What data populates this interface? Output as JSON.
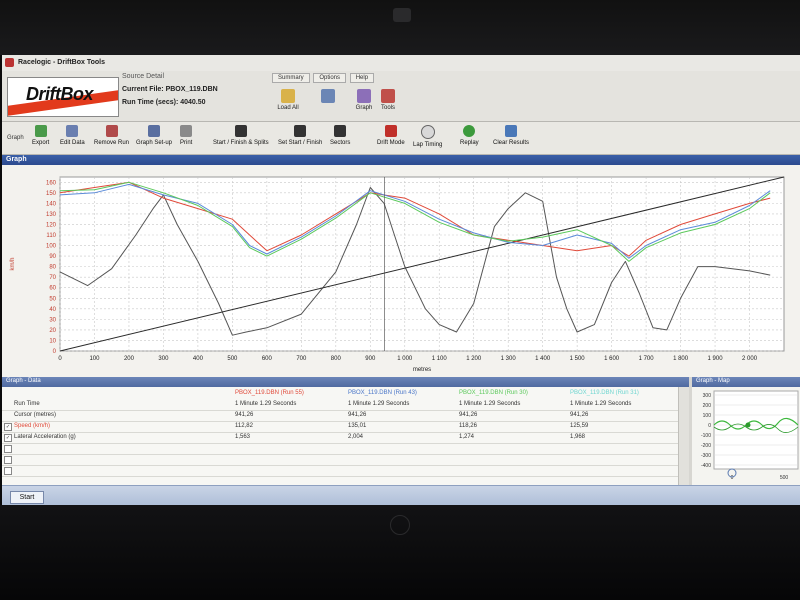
{
  "window": {
    "title": "Racelogic - DriftBox Tools"
  },
  "logo": {
    "text": "DriftBox"
  },
  "source_detail": {
    "header": "Source Detail",
    "current_file_label": "Current File:",
    "current_file": "PBOX_119.DBN",
    "run_time_label": "Run Time (secs):",
    "run_time": "4040.50"
  },
  "menu_tabs": [
    "Summary",
    "Options",
    "Help"
  ],
  "ribbon_buttons": {
    "load_all": "Load All",
    "graph": "Graph",
    "tools": "Tools"
  },
  "toolbar": {
    "group_label": "Graph",
    "buttons": [
      "Export",
      "Edit Data",
      "Remove Run",
      "Graph Set-up",
      "Print",
      "Start / Finish & Splits",
      "Set Start / Finish",
      "Sectors",
      "Drift Mode",
      "Lap Timing",
      "Replay",
      "Clear Results"
    ]
  },
  "graph": {
    "header": "Graph",
    "x_label": "metres",
    "y_label": "km/h",
    "x_ticks": [
      "0",
      "100",
      "200",
      "300",
      "400",
      "500",
      "600",
      "700",
      "800",
      "900",
      "1 000",
      "1 100",
      "1 200",
      "1 300",
      "1 400",
      "1 500",
      "1 600",
      "1 700",
      "1 800",
      "1 900",
      "2 000"
    ],
    "y_ticks": [
      "0",
      "10",
      "20",
      "30",
      "40",
      "50",
      "60",
      "70",
      "80",
      "90",
      "100",
      "110",
      "120",
      "130",
      "140",
      "150",
      "160"
    ]
  },
  "chart_data": {
    "type": "line",
    "xlabel": "metres",
    "ylabel": "km/h",
    "xlim": [
      0,
      2100
    ],
    "ylim": [
      0,
      165
    ],
    "series": [
      {
        "color": "#555555",
        "x": [
          0,
          80,
          150,
          220,
          270,
          300,
          340,
          400,
          460,
          500,
          540,
          600,
          700,
          800,
          860,
          900,
          940,
          970,
          1000,
          1060,
          1100,
          1150,
          1200,
          1260,
          1300,
          1350,
          1400,
          1440,
          1470,
          1500,
          1550,
          1600,
          1640,
          1680,
          1720,
          1760,
          1800,
          1850,
          1900,
          1950,
          2000,
          2060
        ],
        "y": [
          75,
          62,
          78,
          110,
          135,
          148,
          120,
          85,
          45,
          15,
          18,
          22,
          35,
          75,
          120,
          155,
          140,
          110,
          80,
          40,
          25,
          18,
          45,
          118,
          135,
          150,
          142,
          70,
          40,
          18,
          25,
          65,
          85,
          55,
          22,
          20,
          50,
          80,
          80,
          78,
          76,
          72
        ]
      },
      {
        "color": "#2a2a2a",
        "x": [
          0,
          2100
        ],
        "y": [
          0,
          165
        ]
      },
      {
        "color": "#e04a3a",
        "x": [
          0,
          100,
          200,
          300,
          400,
          500,
          550,
          600,
          700,
          800,
          900,
          1000,
          1100,
          1200,
          1300,
          1400,
          1500,
          1600,
          1650,
          1700,
          1800,
          1900,
          2000,
          2060
        ],
        "y": [
          150,
          155,
          160,
          145,
          135,
          125,
          110,
          95,
          110,
          130,
          150,
          145,
          130,
          110,
          105,
          100,
          95,
          100,
          90,
          105,
          120,
          130,
          140,
          145
        ]
      },
      {
        "color": "#5b8bd9",
        "x": [
          0,
          100,
          200,
          300,
          400,
          500,
          550,
          600,
          700,
          800,
          900,
          1000,
          1100,
          1200,
          1300,
          1400,
          1500,
          1600,
          1650,
          1700,
          1800,
          1900,
          2000,
          2060
        ],
        "y": [
          148,
          150,
          158,
          148,
          140,
          120,
          100,
          92,
          108,
          128,
          152,
          142,
          125,
          112,
          103,
          100,
          110,
          102,
          88,
          100,
          115,
          122,
          138,
          152
        ]
      },
      {
        "color": "#5cc95c",
        "x": [
          0,
          100,
          200,
          300,
          400,
          500,
          550,
          600,
          700,
          800,
          900,
          1000,
          1100,
          1200,
          1300,
          1400,
          1500,
          1600,
          1650,
          1700,
          1800,
          1900,
          2000,
          2060
        ],
        "y": [
          152,
          153,
          160,
          150,
          138,
          118,
          98,
          90,
          106,
          126,
          150,
          140,
          122,
          110,
          104,
          108,
          115,
          100,
          85,
          98,
          112,
          120,
          135,
          150
        ]
      }
    ]
  },
  "graph_data": {
    "header": "Graph - Data",
    "columns": [
      "PBOX_119.DBN (Run 55)",
      "PBOX_119.DBN (Run 43)",
      "PBOX_119.DBN (Run 30)",
      "PBOX_119.DBN (Run 31)"
    ],
    "column_colors": [
      "#e04a3a",
      "#4a76c8",
      "#5cc95c",
      "#6fd6d0"
    ],
    "rows": [
      {
        "label": "Run Time",
        "checked": false,
        "values": [
          "1 Minute 1.29 Seconds",
          "1 Minute 1.29 Seconds",
          "1 Minute 1.29 Seconds",
          "1 Minute 1.29 Seconds"
        ]
      },
      {
        "label": "Cursor (metres)",
        "checked": false,
        "values": [
          "941,26",
          "941,26",
          "941,26",
          "941,26"
        ]
      },
      {
        "label": "Speed (km/h)",
        "checked": true,
        "values": [
          "112,82",
          "135,01",
          "118,26",
          "125,59"
        ]
      },
      {
        "label": "Lateral Acceleration (g)",
        "checked": true,
        "values": [
          "1,563",
          "2,004",
          "1,274",
          "1,968"
        ]
      }
    ]
  },
  "map": {
    "header": "Graph - Map",
    "y_ticks": [
      "300",
      "200",
      "100",
      "0",
      "-100",
      "-200",
      "-300",
      "-400"
    ],
    "x_ticks": [
      "0",
      "500"
    ]
  },
  "taskbar": {
    "start": "Start"
  }
}
